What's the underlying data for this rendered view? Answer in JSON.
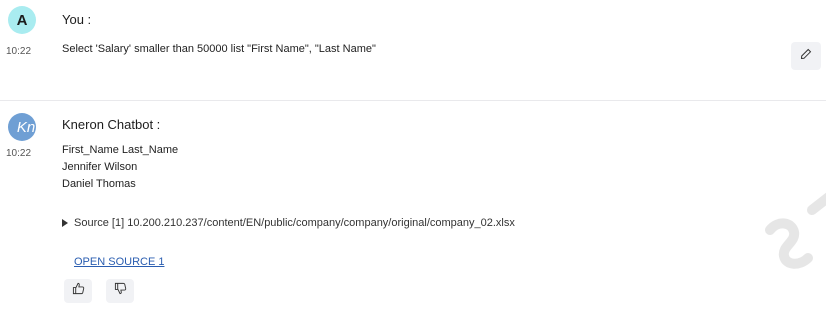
{
  "user_message": {
    "avatar_letter": "A",
    "sender": "You :",
    "time": "10:22",
    "text": "Select 'Salary' smaller than 50000 list \"First Name\", \"Last Name\"",
    "edit_icon": "pencil-icon"
  },
  "bot_message": {
    "avatar_text": "Kn",
    "sender": "Kneron Chatbot :",
    "time": "10:22",
    "answer_lines": [
      "First_Name Last_Name",
      "Jennifer Wilson",
      "Daniel Thomas"
    ],
    "source_text": "Source [1] 10.200.210.237/content/EN/public/company/company/original/company_02.xlsx",
    "open_source_label": "OPEN SOURCE 1",
    "thumbs_up_icon": "thumbs-up-icon",
    "thumbs_down_icon": "thumbs-down-icon"
  },
  "colors": {
    "user_avatar_bg": "#a9ecf0",
    "bot_avatar_bg": "#6f9fd4",
    "link": "#2a5db0",
    "button_bg": "#f1f2f5",
    "divider": "#e9e9ec"
  }
}
